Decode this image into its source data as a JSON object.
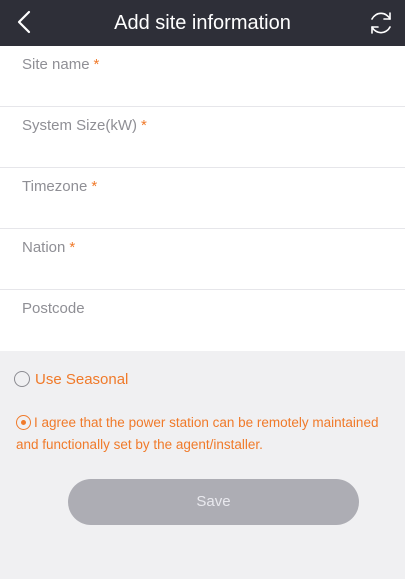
{
  "header": {
    "title": "Add site information",
    "back_icon": "chevron-left-icon",
    "refresh_icon": "refresh-icon"
  },
  "form": {
    "required_marker": "*",
    "fields": [
      {
        "label": "Site name",
        "value": "",
        "required": true
      },
      {
        "label": "System Size(kW)",
        "value": "",
        "required": true
      },
      {
        "label": "Timezone",
        "value": "",
        "required": true
      },
      {
        "label": "Nation",
        "value": "",
        "required": true
      },
      {
        "label": "Postcode",
        "value": "",
        "required": false
      }
    ]
  },
  "options": {
    "seasonal_label": "Use Seasonal",
    "seasonal_checked": false,
    "agreement_text": "I agree that the power station can be remotely maintained and functionally set by the agent/installer.",
    "agreement_checked": true
  },
  "actions": {
    "save_label": "Save"
  },
  "colors": {
    "header_bg": "#2e2f38",
    "accent": "#f07a2a",
    "button_disabled": "#adadb4",
    "page_bg": "#f0f0f2"
  }
}
